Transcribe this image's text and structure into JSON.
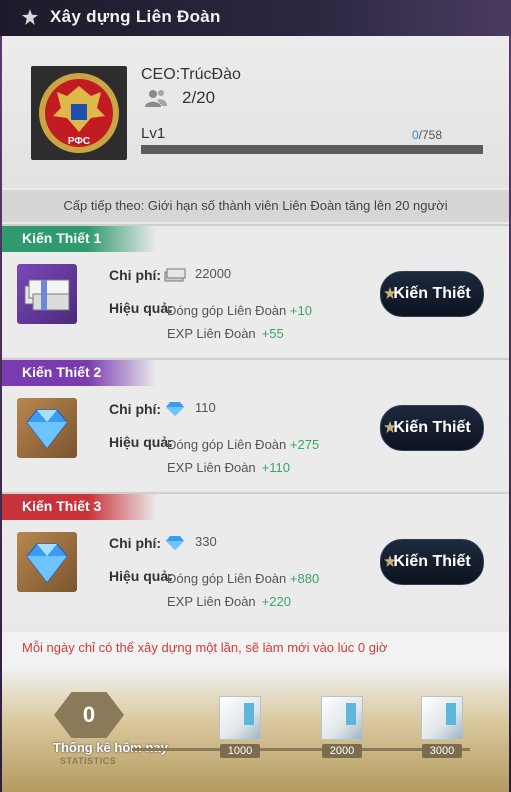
{
  "window": {
    "title": "Xây dựng Liên Đoàn"
  },
  "league": {
    "ceo_label": "CEO:TrúcĐào",
    "members": "2/20",
    "level": "Lv1",
    "xp_current": "0",
    "xp_max": "/758",
    "xp_fraction": 0,
    "logo_text": "РФС"
  },
  "next_level_text": "Cấp tiếp theo: Giới hạn số thành viên Liên Đoàn tăng lên 20 người",
  "labels": {
    "cost": "Chi phí:",
    "effect": "Hiệu quả:"
  },
  "cards": [
    {
      "tag": "Kiến Thiết 1",
      "tag_color": "#2e9a6e",
      "cost_icon": "cash-icon",
      "cost": "22000",
      "effect1_text": "Đóng góp Liên Đoàn",
      "effect1_value": "+10",
      "effect2_text": "EXP Liên Đoàn",
      "effect2_value": "+55",
      "button": "Kiến Thiết"
    },
    {
      "tag": "Kiến Thiết 2",
      "tag_color": "#7b3bb0",
      "cost_icon": "diamond-icon",
      "cost": "110",
      "effect1_text": "Đóng góp Liên Đoàn",
      "effect1_value": "+275",
      "effect2_text": "EXP Liên Đoàn",
      "effect2_value": "+110",
      "button": "Kiến Thiết"
    },
    {
      "tag": "Kiến Thiết 3",
      "tag_color": "#c8323a",
      "cost_icon": "diamond-icon",
      "cost": "330",
      "effect1_text": "Đóng góp Liên Đoàn",
      "effect1_value": "+880",
      "effect2_text": "EXP Liên Đoàn",
      "effect2_value": "+220",
      "button": "Kiến Thiết"
    }
  ],
  "notice": "Mỗi ngày chỉ có thể xây dựng một lần, sẽ làm mới vào lúc 0 giờ",
  "statistics": {
    "count": "0",
    "label": "Thống kê hôm nay",
    "sublabel": "STATISTICS",
    "milestones": [
      "1000",
      "2000",
      "3000"
    ]
  }
}
